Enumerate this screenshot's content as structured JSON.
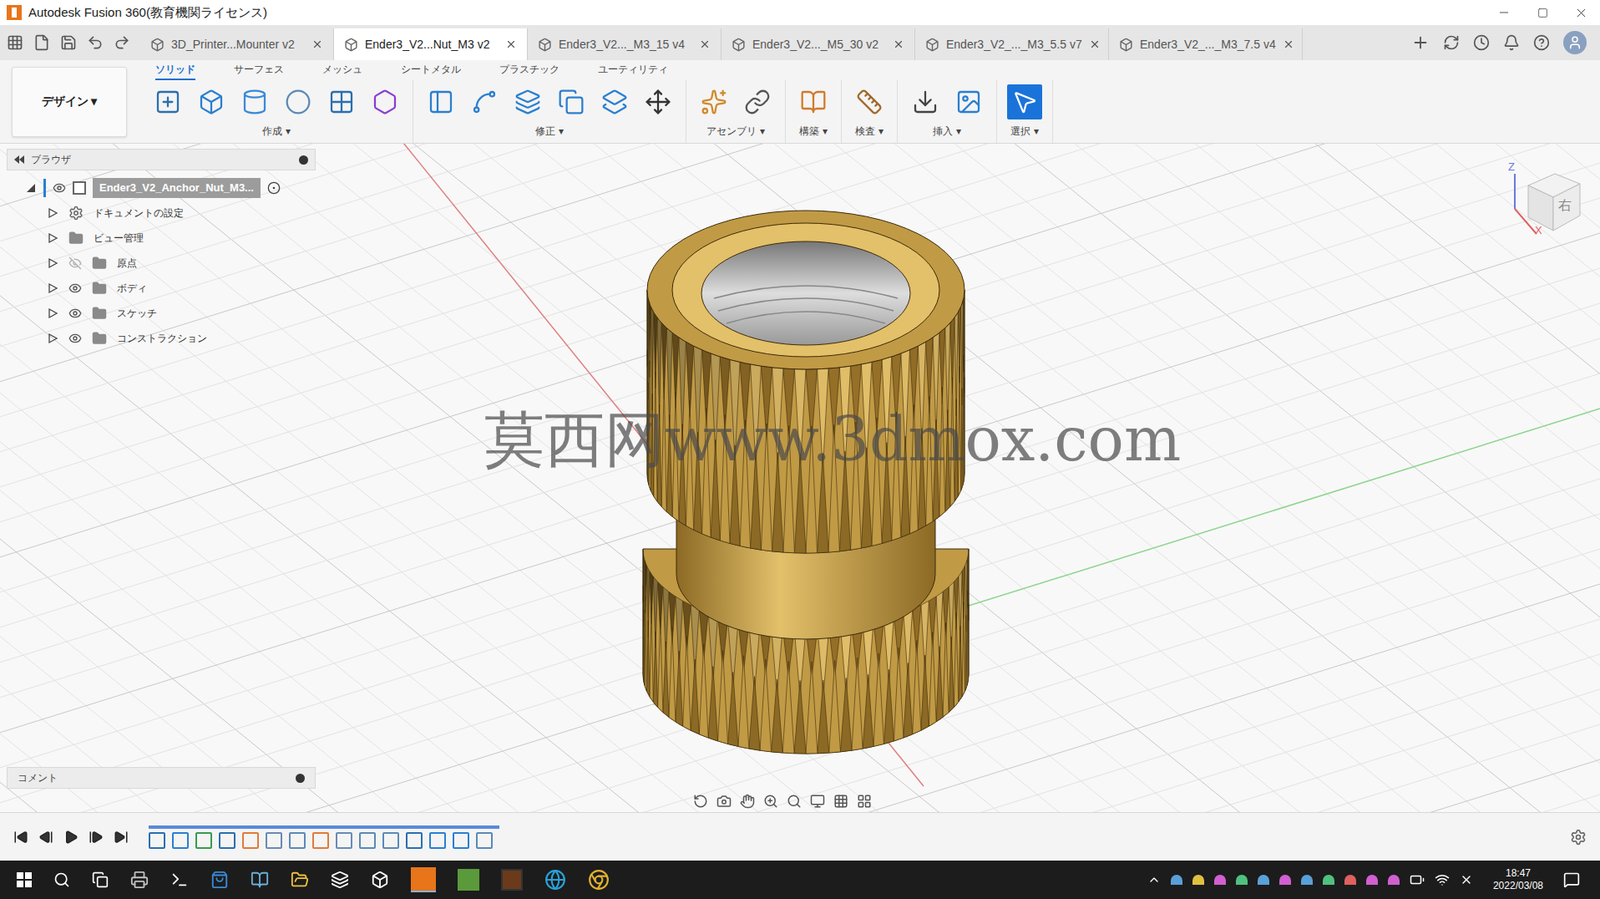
{
  "window": {
    "title": "Autodesk Fusion 360(教育機関ライセンス)"
  },
  "document_tabs": [
    {
      "label": "3D_Printer...Mounter v2",
      "selected": false
    },
    {
      "label": "Ender3_V2...Nut_M3 v2",
      "selected": true
    },
    {
      "label": "Ender3_V2..._M3_15 v4",
      "selected": false
    },
    {
      "label": "Ender3_V2..._M5_30 v2",
      "selected": false
    },
    {
      "label": "Ender3_V2_..._M3_5.5 v7",
      "selected": false
    },
    {
      "label": "Ender3_V2_..._M3_7.5 v4",
      "selected": false
    }
  ],
  "workspace": {
    "label": "デザイン ▾"
  },
  "toolbar_tabs": [
    {
      "label": "ソリッド",
      "selected": true
    },
    {
      "label": "サーフェス",
      "selected": false
    },
    {
      "label": "メッシュ",
      "selected": false
    },
    {
      "label": "シートメタル",
      "selected": false
    },
    {
      "label": "プラスチック",
      "selected": false
    },
    {
      "label": "ユーティリティ",
      "selected": false
    }
  ],
  "toolbar_groups": [
    {
      "label": "作成 ▾",
      "active": false
    },
    {
      "label": "修正 ▾",
      "active": false
    },
    {
      "label": "アセンブリ ▾",
      "active": false
    },
    {
      "label": "構築 ▾",
      "active": false
    },
    {
      "label": "検査 ▾",
      "active": false
    },
    {
      "label": "挿入 ▾",
      "active": false
    },
    {
      "label": "選択 ▾",
      "active": true
    }
  ],
  "browser": {
    "title": "ブラウザ",
    "root": {
      "label": "Ender3_V2_Anchor_Nut_M3...",
      "expanded": true,
      "visible": true,
      "selected": true
    },
    "items": [
      {
        "label": "ドキュメントの設定",
        "kind": "settings",
        "expanded": false
      },
      {
        "label": "ビュー管理",
        "kind": "folder",
        "expanded": false
      },
      {
        "label": "原点",
        "kind": "folder-eye",
        "expanded": false,
        "visible": false
      },
      {
        "label": "ボディ",
        "kind": "folder-eye",
        "expanded": false,
        "visible": true
      },
      {
        "label": "スケッチ",
        "kind": "folder-eye",
        "expanded": false,
        "visible": true
      },
      {
        "label": "コンストラクション",
        "kind": "folder-eye",
        "expanded": false,
        "visible": true
      }
    ]
  },
  "comments": {
    "label": "コメント"
  },
  "watermark": "莫西网www.3dmox.com",
  "viewcube": {
    "face": "右",
    "axes": [
      "Z",
      "X"
    ]
  },
  "taskbar": {
    "time": "18:47",
    "date": "2022/03/08"
  }
}
